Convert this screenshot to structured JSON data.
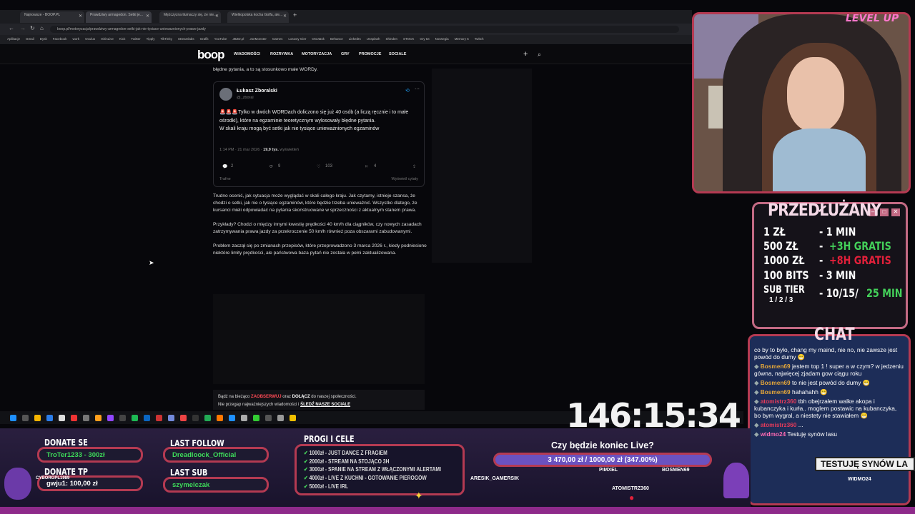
{
  "browser": {
    "tabs": [
      "Najnowsze - BOOP.PL",
      "Prawdziwy armagedon. Setki je...",
      "Mężczyzna tłumaczy się, że nie...",
      "Wielkopolska kocha Golfa, ale..."
    ],
    "url": "boop.pl/motoryzacja/prawdziwy-armagedon-setki-jak-nie-tysiace-uniewaznionych-prawo-jazdy",
    "bookmarks": [
      "Aplikacje",
      "Gmail",
      "Dysk",
      "Facebook",
      "work",
      "Oculus",
      "IshinLive",
      "Kick",
      "Twitter",
      "Tipply",
      "TikTinky",
      "Streamlabs",
      "Grafik",
      "YouTube",
      "JBZD.pl",
      "JoeMonster",
      "Games",
      "Losowy Gier",
      "OGJtask",
      "Behance",
      "LinkedIn",
      "Unsplash",
      "Shinden",
      "STOCK",
      "Gry txt",
      "Norwegia",
      "Memory 5",
      "Twitch"
    ]
  },
  "site": {
    "logo": "boop",
    "nav": [
      "WIADOMOŚCI",
      "ROZRYWKA",
      "MOTORYZACJA",
      "GRY",
      "PROMOCJE",
      "SOCIALE"
    ]
  },
  "article": {
    "intro": "błędne pytania, a to są stosunkowo małe WORDy.",
    "tweet": {
      "author": "Łukasz Zboralski",
      "handle": "@_zboral",
      "body1": "Tylko w dwóch WORDach doliczono się już 40 osób (a liczą ręcznie i to małe ośrodki), które na egzaminie teoretycznym wylosowały błędne pytania.",
      "body2": "W skali kraju mogą być setki jak nie tysiące unieważnionych egzaminów",
      "time": "1:14 PM · 21 mar 2026 ·",
      "views_count": "19,9 tys.",
      "views_label": "wyświetleń",
      "replies": "2",
      "retweets": "9",
      "likes": "103",
      "bookmarks": "4",
      "sort_label": "Trafne",
      "quotes_label": "Wyświetl cytaty"
    },
    "p1": "Trudno ocenić, jak sytuacja może wyglądać w skali całego kraju. Jak czytamy, istnieje szansa, że chodzi o setki, jak nie o tysiące egzaminów, które będzie trzeba unieważnić. Wszystko dlatego, że kursanci mieli odpowiadać na pytania skonstruowane w sprzeczności z aktualnym stanem prawa.",
    "p2": "Przykłady? Chodzi o między innymi kwestię prędkości 40 km/h dla ciągników, czy nowych zasadach zatrzymywania prawa jazdy za przekroczenie 50 km/h również poza obszarami zabudowanymi.",
    "p3": "Problem zaczął się po zmianach przepisów, które przeprowadzono 3 marca 2026 r., kiedy podniesiono niektóre limity prędkości, ale państwowa baza pytań nie została w pełni zaktualizowana.",
    "promo_line1_a": "Bądź na bieżąco",
    "promo_line1_b": "ZAOBSERWUJ",
    "promo_line1_c": "oraz",
    "promo_line1_d": "DOŁĄCZ",
    "promo_line1_e": "do naszej społeczności.",
    "promo_line2_a": "Nie przegap najważniejszych wiadomości i",
    "promo_line2_b": "ŚLEDŹ NASZE SOCIALE"
  },
  "overlay": {
    "cam_badge": "LEVEL UP",
    "extended_title": "PRZEDŁUŻANY",
    "extended_rows": [
      {
        "amount": "1 ZŁ",
        "value": "- 1 MIN",
        "extra": ""
      },
      {
        "amount": "500 ZŁ",
        "value": "-",
        "extra": "+3H GRATIS"
      },
      {
        "amount": "1000 ZŁ",
        "value": "-",
        "extra": "+8H GRATIS"
      },
      {
        "amount": "100 BITS",
        "value": "- 3 MIN",
        "extra": ""
      },
      {
        "amount": "SUB TIER",
        "value": "- 10/15/",
        "extra": "25 MIN"
      }
    ],
    "tier_sub": "1 / 2 / 3",
    "chat_title": "CHAT",
    "chat": [
      {
        "user": "",
        "text": "co by to było, chang my maind, nie no, nie zawsze jest powód do dumy 😁",
        "color": "#ffffff"
      },
      {
        "user": "Bosmen69",
        "text": "jestem top 1 ! super a w czym? w jedzeniu gówna, najwięcej zjadam gow ciągu roku",
        "color": "#e3a63a"
      },
      {
        "user": "Bosmen69",
        "text": "to nie jest powód do dumy 😁",
        "color": "#e3a63a"
      },
      {
        "user": "Bosmen69",
        "text": "hahahahh 😁",
        "color": "#e3a63a"
      },
      {
        "user": "atomistrz360",
        "text": "tbh obejrzałem walke akopa i kubanczyka i kurła.. moglem postawic na kubanczyka, bo bym wygral, a niestety nie stawiałem 😁",
        "color": "#e53b5a"
      },
      {
        "user": "atomistrz360",
        "text": "...",
        "color": "#e53b5a"
      },
      {
        "user": "widmo24",
        "text": "Testuję synów lasu",
        "color": "#ff6ab3"
      }
    ],
    "chat_banner": "TESTUJĘ SYNÓW LA",
    "timer": "146:15:34",
    "donate_label": "DONATE SE",
    "donate_value": "TroTer1233 - 300zł",
    "donate_tp_label": "DONATE TP",
    "donate_tp_value": "gwju1: 100,00 zł",
    "last_follow_label": "LAST FOLLOW",
    "last_follow_value": "Dreadloock_Official",
    "last_sub_label": "LAST SUB",
    "last_sub_value": "szymelczak",
    "progi_title": "PROGI I CELE",
    "progi": [
      "1000zł - JUST DANCE Z FRAGIEM",
      "2000zł - STREAM NA STOJĄCO 3H",
      "3000zł - SPANIE NA STREAM Z WŁĄCZONYMI ALERTAMI",
      "4000zł - LIVE Z KUCHNI - GOTOWANIE PIEROGÓW",
      "5000zł - LIVE IRL"
    ],
    "goal_title": "Czy będzie koniec Live?",
    "goal_text": "3 470,00 zł / 1000,00 zł (347.00%)",
    "goal_fraction": 1.0,
    "names": [
      "CYBORGPL1989",
      "ARESIK_GAMERSIK",
      "PIMXEL",
      "BOSMEN69",
      "ATOMISTRZ360",
      "WIDMO24",
      "CYBORGPL1989"
    ]
  },
  "colors": {
    "accent": "#b43a52",
    "green": "#44d15a",
    "red": "#e2203a",
    "chat_bg": "#1d2d58"
  }
}
